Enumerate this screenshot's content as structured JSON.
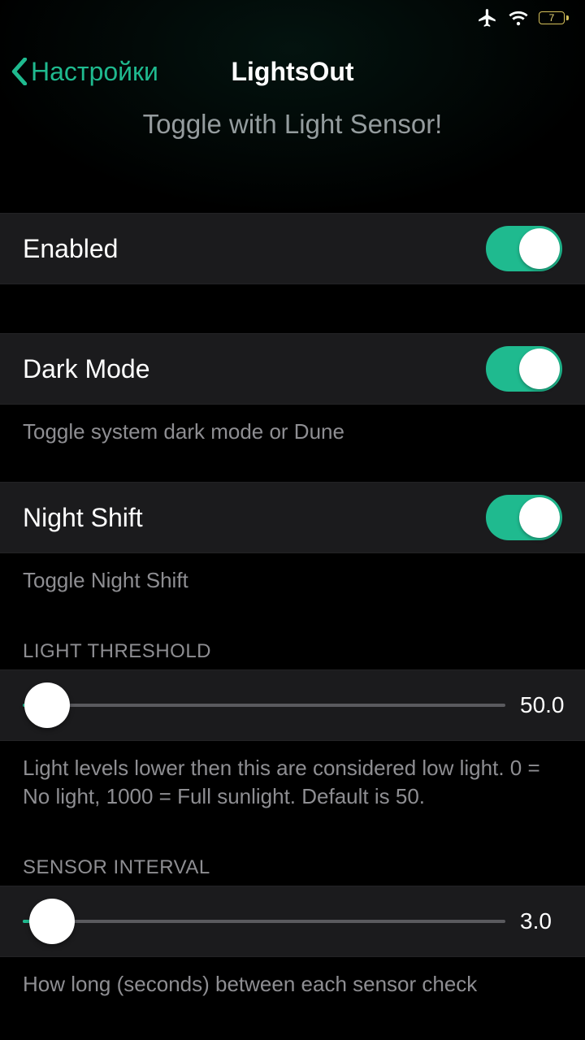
{
  "statusbar": {
    "battery": "7"
  },
  "nav": {
    "back": "Настройки",
    "title": "LightsOut"
  },
  "subtitle": "Toggle with Light Sensor!",
  "rows": {
    "enabled": {
      "label": "Enabled",
      "on": true
    },
    "darkmode": {
      "label": "Dark Mode",
      "on": true,
      "footer": "Toggle system dark mode or Dune"
    },
    "nightshift": {
      "label": "Night Shift",
      "on": true,
      "footer": "Toggle Night Shift"
    }
  },
  "sections": {
    "threshold": {
      "header": "LIGHT THRESHOLD",
      "value_text": "50.0",
      "value": 50,
      "min": 0,
      "max": 1000,
      "footer": "Light levels lower then this are considered low light. 0 = No light, 1000 = Full sunlight. Default is 50."
    },
    "interval": {
      "header": "SENSOR INTERVAL",
      "value_text": "3.0",
      "value": 3,
      "percent": 6,
      "footer": "How long (seconds) between each sensor check"
    }
  },
  "colors": {
    "accent": "#1fba8f"
  }
}
